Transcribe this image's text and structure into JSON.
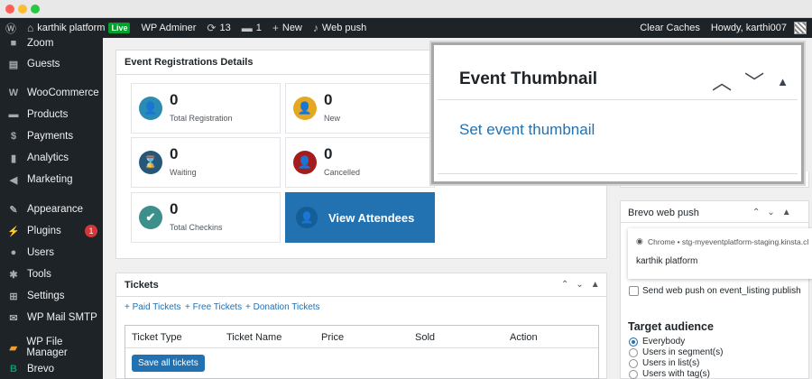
{
  "adminbar": {
    "site_name": "karthik platform",
    "live_badge": "Live",
    "wp_adminer": "WP Adminer",
    "updates_count": "13",
    "comments_count": "1",
    "new_label": "New",
    "web_push": "Web push",
    "clear_caches": "Clear Caches",
    "howdy": "Howdy, karthi007"
  },
  "sidebar": {
    "items": [
      {
        "label": "Zoom",
        "icon": "zoom-icon"
      },
      {
        "label": "Guests",
        "icon": "guests-icon"
      },
      {
        "label": "WooCommerce",
        "icon": "woocommerce-icon"
      },
      {
        "label": "Products",
        "icon": "products-icon"
      },
      {
        "label": "Payments",
        "icon": "payments-icon"
      },
      {
        "label": "Analytics",
        "icon": "analytics-icon"
      },
      {
        "label": "Marketing",
        "icon": "marketing-icon"
      },
      {
        "label": "Appearance",
        "icon": "appearance-icon"
      },
      {
        "label": "Plugins",
        "icon": "plugins-icon",
        "badge": "1"
      },
      {
        "label": "Users",
        "icon": "users-icon"
      },
      {
        "label": "Tools",
        "icon": "tools-icon"
      },
      {
        "label": "Settings",
        "icon": "settings-icon"
      },
      {
        "label": "WP Mail SMTP",
        "icon": "mail-icon"
      },
      {
        "label": "WP File Manager",
        "icon": "file-manager-icon"
      },
      {
        "label": "Brevo",
        "icon": "brevo-icon"
      }
    ]
  },
  "registrations": {
    "title": "Event Registrations Details",
    "stats": [
      {
        "value": "0",
        "label": "Total Registration",
        "color": "#2a8bb5"
      },
      {
        "value": "0",
        "label": "New",
        "color": "#e5a823"
      },
      {
        "value": "0",
        "label": "Waiting",
        "color": "#24577a"
      },
      {
        "value": "0",
        "label": "Cancelled",
        "color": "#a51c1c"
      },
      {
        "value": "0",
        "label": "Total Checkins",
        "color": "#3c8f8a"
      }
    ],
    "view_attendees": "View Attendees"
  },
  "tickets": {
    "title": "Tickets",
    "add_links": [
      "+ Paid Tickets",
      "+ Free Tickets",
      "+ Donation Tickets"
    ],
    "columns": [
      "Ticket Type",
      "Ticket Name",
      "Price",
      "Sold",
      "Action"
    ],
    "save_all": "Save all tickets"
  },
  "thumbnail": {
    "title": "Event Thumbnail",
    "set_link": "Set event thumbnail"
  },
  "brevo_push": {
    "title": "Brevo web push",
    "preview_url": "Chrome • stg-myeventplatform-staging.kinsta.cl",
    "preview_title": "karthik platform",
    "send_label": "Send web push on event_listing publish",
    "target_title": "Target audience",
    "audience_options": [
      "Everybody",
      "Users in segment(s)",
      "Users in list(s)",
      "Users with tag(s)"
    ],
    "selected_audience": "Everybody"
  },
  "colors": {
    "admin_dark": "#1d2327",
    "accent_blue": "#2271b1",
    "badge_red": "#d63638",
    "live_green": "#00a32a"
  }
}
